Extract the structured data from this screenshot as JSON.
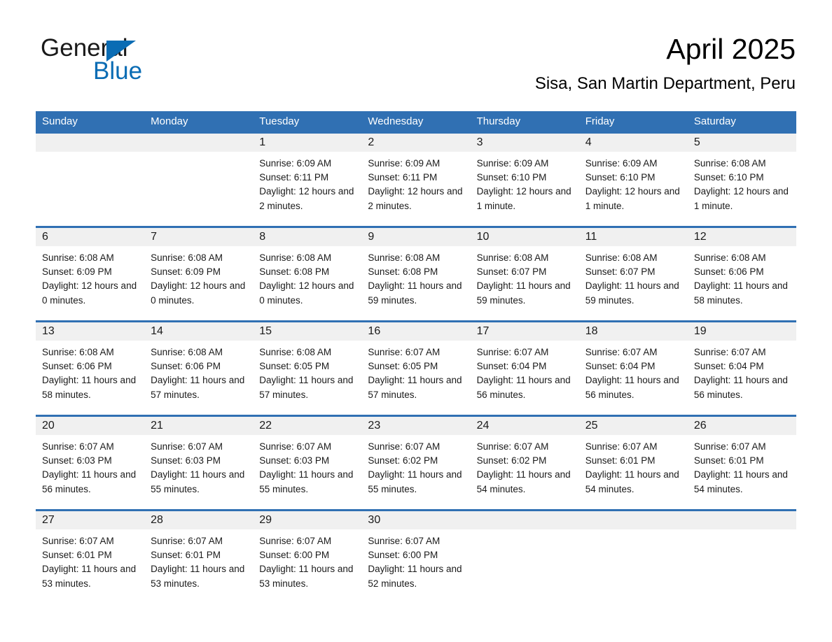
{
  "brand": {
    "name_part1": "General",
    "name_part2": "Blue",
    "triangle_color": "#0a6cb4"
  },
  "header": {
    "title": "April 2025",
    "subtitle": "Sisa, San Martin Department, Peru"
  },
  "theme": {
    "header_blue": "#3070b3",
    "day_strip_gray": "#f0f0f0",
    "text_color": "#1a1a1a"
  },
  "weekdays": [
    "Sunday",
    "Monday",
    "Tuesday",
    "Wednesday",
    "Thursday",
    "Friday",
    "Saturday"
  ],
  "weeks": [
    [
      {
        "empty": true
      },
      {
        "empty": true
      },
      {
        "day": "1",
        "sunrise": "Sunrise: 6:09 AM",
        "sunset": "Sunset: 6:11 PM",
        "daylight": "Daylight: 12 hours and 2 minutes."
      },
      {
        "day": "2",
        "sunrise": "Sunrise: 6:09 AM",
        "sunset": "Sunset: 6:11 PM",
        "daylight": "Daylight: 12 hours and 2 minutes."
      },
      {
        "day": "3",
        "sunrise": "Sunrise: 6:09 AM",
        "sunset": "Sunset: 6:10 PM",
        "daylight": "Daylight: 12 hours and 1 minute."
      },
      {
        "day": "4",
        "sunrise": "Sunrise: 6:09 AM",
        "sunset": "Sunset: 6:10 PM",
        "daylight": "Daylight: 12 hours and 1 minute."
      },
      {
        "day": "5",
        "sunrise": "Sunrise: 6:08 AM",
        "sunset": "Sunset: 6:10 PM",
        "daylight": "Daylight: 12 hours and 1 minute."
      }
    ],
    [
      {
        "day": "6",
        "sunrise": "Sunrise: 6:08 AM",
        "sunset": "Sunset: 6:09 PM",
        "daylight": "Daylight: 12 hours and 0 minutes."
      },
      {
        "day": "7",
        "sunrise": "Sunrise: 6:08 AM",
        "sunset": "Sunset: 6:09 PM",
        "daylight": "Daylight: 12 hours and 0 minutes."
      },
      {
        "day": "8",
        "sunrise": "Sunrise: 6:08 AM",
        "sunset": "Sunset: 6:08 PM",
        "daylight": "Daylight: 12 hours and 0 minutes."
      },
      {
        "day": "9",
        "sunrise": "Sunrise: 6:08 AM",
        "sunset": "Sunset: 6:08 PM",
        "daylight": "Daylight: 11 hours and 59 minutes."
      },
      {
        "day": "10",
        "sunrise": "Sunrise: 6:08 AM",
        "sunset": "Sunset: 6:07 PM",
        "daylight": "Daylight: 11 hours and 59 minutes."
      },
      {
        "day": "11",
        "sunrise": "Sunrise: 6:08 AM",
        "sunset": "Sunset: 6:07 PM",
        "daylight": "Daylight: 11 hours and 59 minutes."
      },
      {
        "day": "12",
        "sunrise": "Sunrise: 6:08 AM",
        "sunset": "Sunset: 6:06 PM",
        "daylight": "Daylight: 11 hours and 58 minutes."
      }
    ],
    [
      {
        "day": "13",
        "sunrise": "Sunrise: 6:08 AM",
        "sunset": "Sunset: 6:06 PM",
        "daylight": "Daylight: 11 hours and 58 minutes."
      },
      {
        "day": "14",
        "sunrise": "Sunrise: 6:08 AM",
        "sunset": "Sunset: 6:06 PM",
        "daylight": "Daylight: 11 hours and 57 minutes."
      },
      {
        "day": "15",
        "sunrise": "Sunrise: 6:08 AM",
        "sunset": "Sunset: 6:05 PM",
        "daylight": "Daylight: 11 hours and 57 minutes."
      },
      {
        "day": "16",
        "sunrise": "Sunrise: 6:07 AM",
        "sunset": "Sunset: 6:05 PM",
        "daylight": "Daylight: 11 hours and 57 minutes."
      },
      {
        "day": "17",
        "sunrise": "Sunrise: 6:07 AM",
        "sunset": "Sunset: 6:04 PM",
        "daylight": "Daylight: 11 hours and 56 minutes."
      },
      {
        "day": "18",
        "sunrise": "Sunrise: 6:07 AM",
        "sunset": "Sunset: 6:04 PM",
        "daylight": "Daylight: 11 hours and 56 minutes."
      },
      {
        "day": "19",
        "sunrise": "Sunrise: 6:07 AM",
        "sunset": "Sunset: 6:04 PM",
        "daylight": "Daylight: 11 hours and 56 minutes."
      }
    ],
    [
      {
        "day": "20",
        "sunrise": "Sunrise: 6:07 AM",
        "sunset": "Sunset: 6:03 PM",
        "daylight": "Daylight: 11 hours and 56 minutes."
      },
      {
        "day": "21",
        "sunrise": "Sunrise: 6:07 AM",
        "sunset": "Sunset: 6:03 PM",
        "daylight": "Daylight: 11 hours and 55 minutes."
      },
      {
        "day": "22",
        "sunrise": "Sunrise: 6:07 AM",
        "sunset": "Sunset: 6:03 PM",
        "daylight": "Daylight: 11 hours and 55 minutes."
      },
      {
        "day": "23",
        "sunrise": "Sunrise: 6:07 AM",
        "sunset": "Sunset: 6:02 PM",
        "daylight": "Daylight: 11 hours and 55 minutes."
      },
      {
        "day": "24",
        "sunrise": "Sunrise: 6:07 AM",
        "sunset": "Sunset: 6:02 PM",
        "daylight": "Daylight: 11 hours and 54 minutes."
      },
      {
        "day": "25",
        "sunrise": "Sunrise: 6:07 AM",
        "sunset": "Sunset: 6:01 PM",
        "daylight": "Daylight: 11 hours and 54 minutes."
      },
      {
        "day": "26",
        "sunrise": "Sunrise: 6:07 AM",
        "sunset": "Sunset: 6:01 PM",
        "daylight": "Daylight: 11 hours and 54 minutes."
      }
    ],
    [
      {
        "day": "27",
        "sunrise": "Sunrise: 6:07 AM",
        "sunset": "Sunset: 6:01 PM",
        "daylight": "Daylight: 11 hours and 53 minutes."
      },
      {
        "day": "28",
        "sunrise": "Sunrise: 6:07 AM",
        "sunset": "Sunset: 6:01 PM",
        "daylight": "Daylight: 11 hours and 53 minutes."
      },
      {
        "day": "29",
        "sunrise": "Sunrise: 6:07 AM",
        "sunset": "Sunset: 6:00 PM",
        "daylight": "Daylight: 11 hours and 53 minutes."
      },
      {
        "day": "30",
        "sunrise": "Sunrise: 6:07 AM",
        "sunset": "Sunset: 6:00 PM",
        "daylight": "Daylight: 11 hours and 52 minutes."
      },
      {
        "empty": true
      },
      {
        "empty": true
      },
      {
        "empty": true
      }
    ]
  ]
}
